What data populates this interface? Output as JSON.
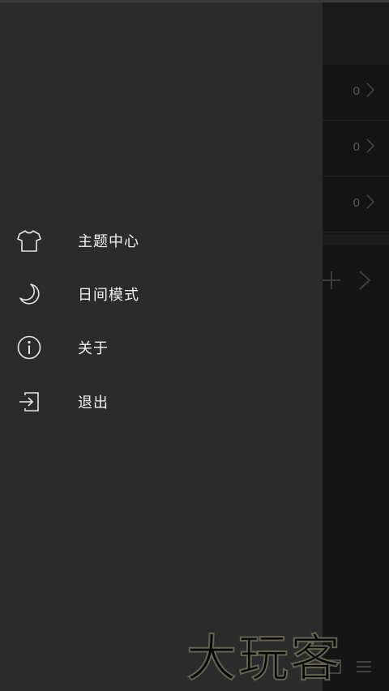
{
  "background_list": {
    "rows": [
      {
        "count": "0"
      },
      {
        "count": "0"
      },
      {
        "count": "0"
      }
    ],
    "add_icon": "plus-icon",
    "next_icon": "chevron-right-icon"
  },
  "drawer": {
    "items": [
      {
        "label": "主题中心",
        "icon": "tshirt-icon"
      },
      {
        "label": "日间模式",
        "icon": "moon-icon"
      },
      {
        "label": "关于",
        "icon": "info-icon"
      },
      {
        "label": "退出",
        "icon": "exit-icon"
      }
    ]
  },
  "watermark": {
    "text": "大玩客"
  },
  "colors": {
    "drawer_bg": "#2b2b2b",
    "app_bg": "#151515",
    "text": "#f2f2f2"
  }
}
